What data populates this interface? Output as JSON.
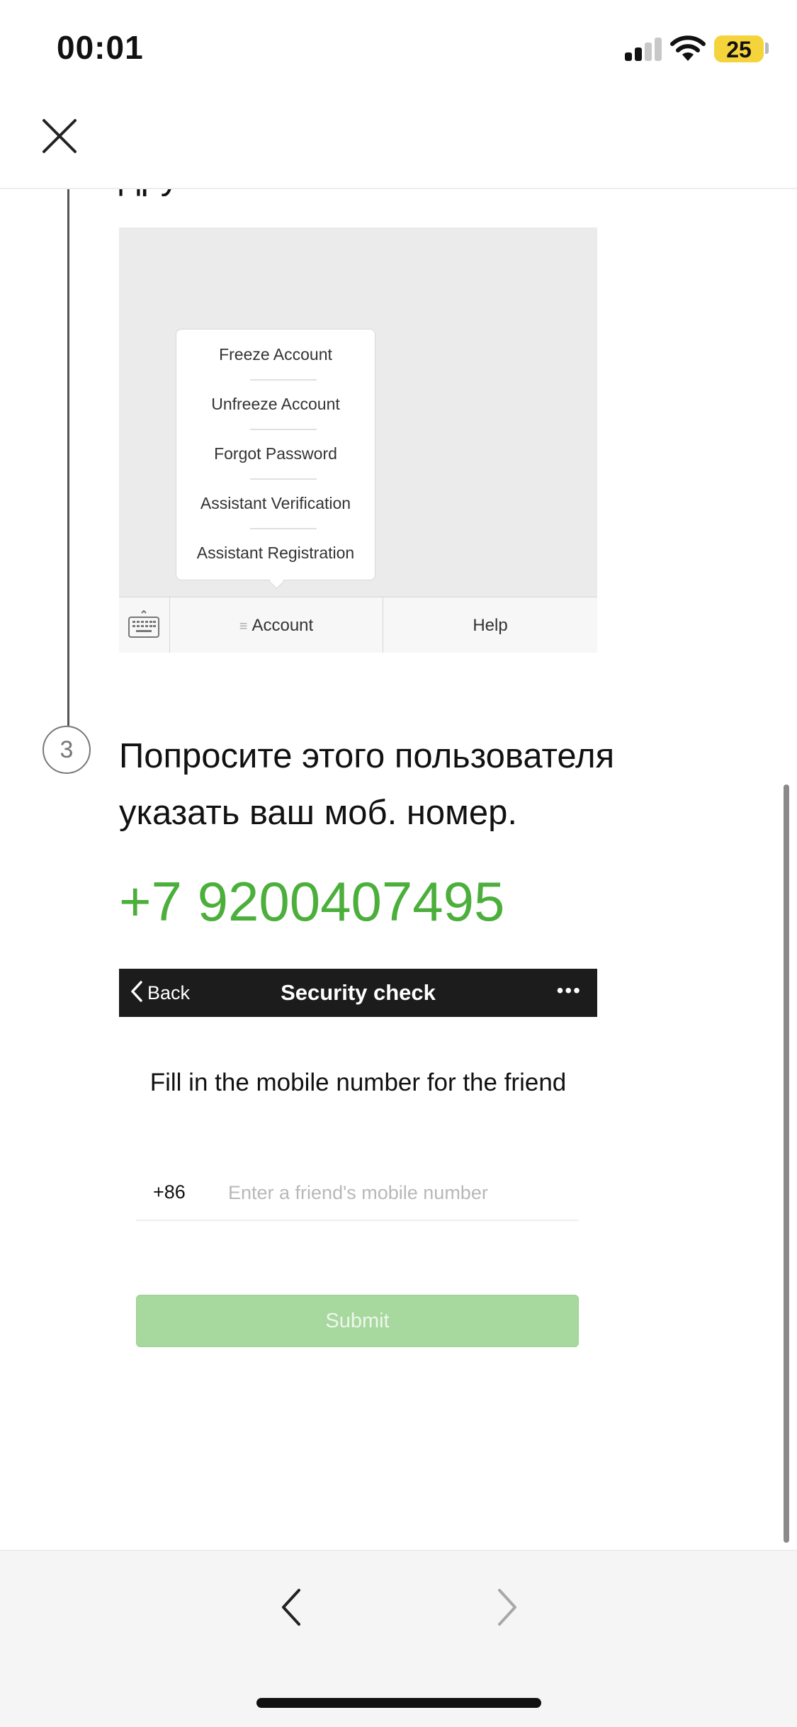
{
  "status_bar": {
    "time": "00:01",
    "battery": "25",
    "battery_fraction": 0.25,
    "signal_bars": 2
  },
  "step2": {
    "partial_title": "друга:"
  },
  "menu_screenshot": {
    "popup_items": [
      "Freeze Account",
      "Unfreeze Account",
      "Forgot Password",
      "Assistant Verification",
      "Assistant Registration"
    ],
    "bottom_menu": {
      "account": "Account",
      "help": "Help"
    }
  },
  "step3": {
    "number": "3",
    "text": "Попросите этого пользователя указать ваш моб. номер.",
    "phone": "+7 9200407495",
    "phone_color": "#4caf3c"
  },
  "security_screenshot": {
    "back_label": "Back",
    "title": "Security check",
    "more": "•••",
    "instruction": "Fill in the mobile number for the friend",
    "country_code": "+86",
    "input_placeholder": "Enter a friend's mobile number",
    "submit_label": "Submit",
    "submit_color": "#a7d89e"
  },
  "icons": {
    "close": "close-icon",
    "keyboard": "keyboard-icon",
    "back_chevron": "chevron-left-icon",
    "forward_chevron": "chevron-right-icon"
  }
}
